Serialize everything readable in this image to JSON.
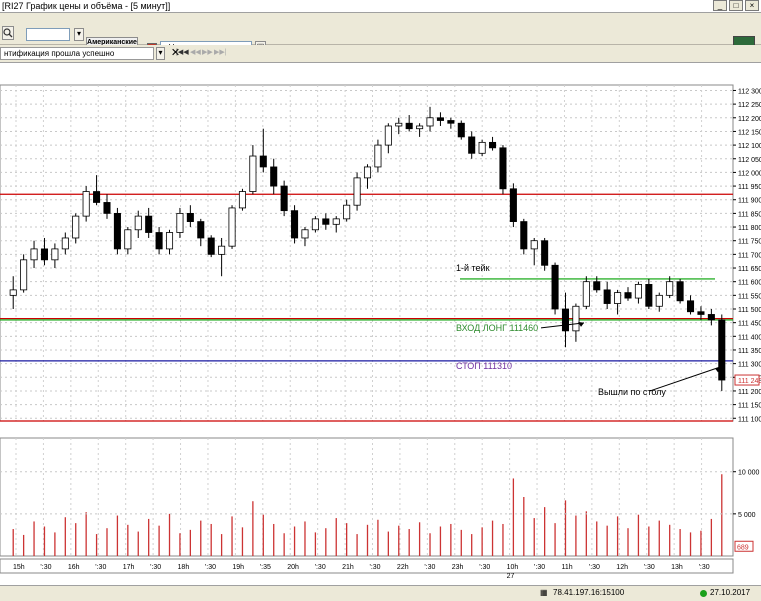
{
  "window": {
    "title": "[RI27 График цены и объёма - [5 минут]]",
    "btn_min": "_",
    "btn_max": "□",
    "btn_close": "×"
  },
  "toolbar": {
    "advert_label": "Американские теперь в Qt",
    "instrument_select": "<Не указано>",
    "status_message": "нтификация прошла успешно",
    "nav_first": "|◀◀",
    "nav_prev": "◀◀",
    "nav_next": "▶▶",
    "nav_last": "▶▶|"
  },
  "statusbar": {
    "connection": "78.41.197.16:15100",
    "date": "27.10.2017"
  },
  "colors": {
    "up": "#ffffff",
    "down": "#000000",
    "red_line": "#cc0000",
    "green_line": "#00a000",
    "blue_line": "#1a1aa0",
    "volume": "#cc3333",
    "stop_text": "#7030a0",
    "entry_text": "#2e8b2e"
  },
  "chart_data": [
    {
      "type": "candlestick",
      "title": "",
      "ylim": [
        111090,
        112320
      ],
      "y_ticks": [
        "112 300",
        "112 250",
        "112 200",
        "112 150",
        "112 100",
        "112 050",
        "112 000",
        "111 950",
        "111 900",
        "111 850",
        "111 800",
        "111 750",
        "111 700",
        "111 650",
        "111 600",
        "111 550",
        "111 500",
        "111 450",
        "111 400",
        "111 350",
        "111 300",
        "111 250",
        "111 200",
        "111 150",
        "111 100"
      ],
      "last_price_label": "111 240",
      "candles": [
        [
          111550,
          111620,
          111500,
          111570
        ],
        [
          111570,
          111700,
          111560,
          111680
        ],
        [
          111680,
          111750,
          111650,
          111720
        ],
        [
          111720,
          111760,
          111660,
          111680
        ],
        [
          111680,
          111740,
          111650,
          111720
        ],
        [
          111720,
          111780,
          111700,
          111760
        ],
        [
          111760,
          111850,
          111740,
          111840
        ],
        [
          111840,
          111950,
          111820,
          111930
        ],
        [
          111930,
          111990,
          111880,
          111890
        ],
        [
          111890,
          111920,
          111830,
          111850
        ],
        [
          111850,
          111870,
          111700,
          111720
        ],
        [
          111720,
          111800,
          111700,
          111790
        ],
        [
          111790,
          111860,
          111760,
          111840
        ],
        [
          111840,
          111870,
          111760,
          111780
        ],
        [
          111780,
          111800,
          111700,
          111720
        ],
        [
          111720,
          111790,
          111700,
          111780
        ],
        [
          111780,
          111870,
          111760,
          111850
        ],
        [
          111850,
          111880,
          111800,
          111820
        ],
        [
          111820,
          111830,
          111730,
          111760
        ],
        [
          111760,
          111770,
          111690,
          111700
        ],
        [
          111700,
          111760,
          111620,
          111730
        ],
        [
          111730,
          111880,
          111720,
          111870
        ],
        [
          111870,
          111940,
          111860,
          111930
        ],
        [
          111930,
          112100,
          111920,
          112060
        ],
        [
          112060,
          112160,
          112000,
          112020
        ],
        [
          112020,
          112050,
          111920,
          111950
        ],
        [
          111950,
          111970,
          111840,
          111860
        ],
        [
          111860,
          111880,
          111740,
          111760
        ],
        [
          111760,
          111800,
          111730,
          111790
        ],
        [
          111790,
          111840,
          111780,
          111830
        ],
        [
          111830,
          111850,
          111790,
          111810
        ],
        [
          111810,
          111840,
          111780,
          111830
        ],
        [
          111830,
          111900,
          111820,
          111880
        ],
        [
          111880,
          112000,
          111860,
          111980
        ],
        [
          111980,
          112030,
          111940,
          112020
        ],
        [
          112020,
          112120,
          112000,
          112100
        ],
        [
          112100,
          112180,
          112070,
          112170
        ],
        [
          112170,
          112200,
          112140,
          112180
        ],
        [
          112180,
          112210,
          112150,
          112160
        ],
        [
          112160,
          112180,
          112130,
          112170
        ],
        [
          112170,
          112240,
          112150,
          112200
        ],
        [
          112200,
          112220,
          112170,
          112190
        ],
        [
          112190,
          112200,
          112160,
          112180
        ],
        [
          112180,
          112190,
          112120,
          112130
        ],
        [
          112130,
          112150,
          112050,
          112070
        ],
        [
          112070,
          112120,
          112060,
          112110
        ],
        [
          112110,
          112130,
          112080,
          112090
        ],
        [
          112090,
          112100,
          111920,
          111940
        ],
        [
          111940,
          111960,
          111800,
          111820
        ],
        [
          111820,
          111830,
          111700,
          111720
        ],
        [
          111720,
          111760,
          111660,
          111750
        ],
        [
          111750,
          111760,
          111640,
          111660
        ],
        [
          111660,
          111670,
          111480,
          111500
        ],
        [
          111500,
          111560,
          111360,
          111420
        ],
        [
          111420,
          111520,
          111380,
          111510
        ],
        [
          111510,
          111620,
          111500,
          111600
        ],
        [
          111600,
          111620,
          111560,
          111570
        ],
        [
          111570,
          111600,
          111500,
          111520
        ],
        [
          111520,
          111570,
          111480,
          111560
        ],
        [
          111560,
          111580,
          111530,
          111540
        ],
        [
          111540,
          111600,
          111520,
          111590
        ],
        [
          111590,
          111610,
          111500,
          111510
        ],
        [
          111510,
          111560,
          111490,
          111550
        ],
        [
          111550,
          111620,
          111540,
          111600
        ],
        [
          111600,
          111610,
          111520,
          111530
        ],
        [
          111530,
          111550,
          111480,
          111490
        ],
        [
          111490,
          111510,
          111460,
          111480
        ],
        [
          111480,
          111500,
          111440,
          111460
        ],
        [
          111460,
          111480,
          111200,
          111240
        ]
      ],
      "hlines": [
        {
          "price": 111920,
          "color": "red"
        },
        {
          "price": 111465,
          "color": "red"
        },
        {
          "price": 111460,
          "color": "green"
        },
        {
          "price": 111310,
          "color": "blue"
        },
        {
          "price": 111090,
          "color": "red"
        },
        {
          "price": 111610,
          "color": "green"
        }
      ],
      "annotations": [
        {
          "text": "1-й тейк",
          "price": 111640,
          "color": "#000000"
        },
        {
          "text": "ВХОД ЛОНГ 111460",
          "price": 111420,
          "color": "#2e8b2e"
        },
        {
          "text": "СТОП 111310",
          "price": 111280,
          "color": "#7030a0"
        },
        {
          "text": "Вышли по столу",
          "price": 111185,
          "color": "#000000"
        }
      ]
    },
    {
      "type": "bar",
      "title": "",
      "ylim": [
        0,
        14000
      ],
      "y_ticks": [
        "10 000",
        "5 000"
      ],
      "last_value_label": "689",
      "values": [
        3200,
        2500,
        4100,
        3500,
        2800,
        4600,
        3900,
        5200,
        2600,
        3300,
        4800,
        3700,
        2900,
        4400,
        3600,
        5000,
        2700,
        3100,
        4200,
        3800,
        2600,
        4700,
        3400,
        6500,
        4900,
        3800,
        2700,
        3500,
        4100,
        2800,
        3300,
        4500,
        3900,
        2600,
        3700,
        4300,
        2900,
        3600,
        3200,
        4000,
        2700,
        3500,
        3800,
        3100,
        2600,
        3400,
        4200,
        3800,
        9200,
        7000,
        4500,
        5800,
        3900,
        6600,
        4800,
        5300,
        4100,
        3600,
        4700,
        3300,
        4900,
        3500,
        4200,
        3700,
        3200,
        2800,
        3000,
        4400,
        9700
      ],
      "x_ticks": [
        "15h",
        "':30",
        "16h",
        "':30",
        "17h",
        "':30",
        "18h",
        "':30",
        "19h",
        "':35",
        "20h",
        "':30",
        "21h",
        "':30",
        "22h",
        "':30",
        "23h",
        "':30",
        "10h",
        "':30",
        "11h",
        "':30",
        "12h",
        "':30",
        "13h",
        "':30"
      ],
      "x_subtick": "27"
    }
  ]
}
